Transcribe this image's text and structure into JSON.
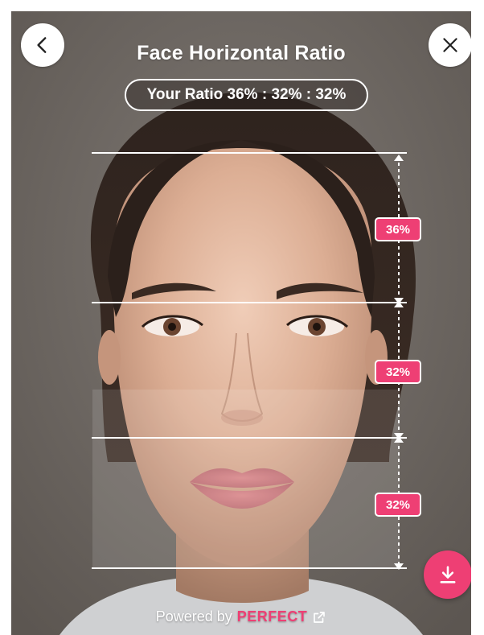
{
  "header": {
    "title": "Face Horizontal Ratio"
  },
  "ratio": {
    "label": "Your Ratio 36% : 32% : 32%"
  },
  "segments": [
    {
      "label": "36%",
      "value": 36
    },
    {
      "label": "32%",
      "value": 32
    },
    {
      "label": "32%",
      "value": 32
    }
  ],
  "footer": {
    "powered_by": "Powered by",
    "brand": "PERFECT"
  },
  "colors": {
    "accent": "#ee3f74",
    "line": "#ffffff",
    "background": "#6f6963"
  },
  "icons": {
    "back": "chevron-left-icon",
    "close": "close-icon",
    "download": "download-icon",
    "external": "external-link-icon"
  }
}
